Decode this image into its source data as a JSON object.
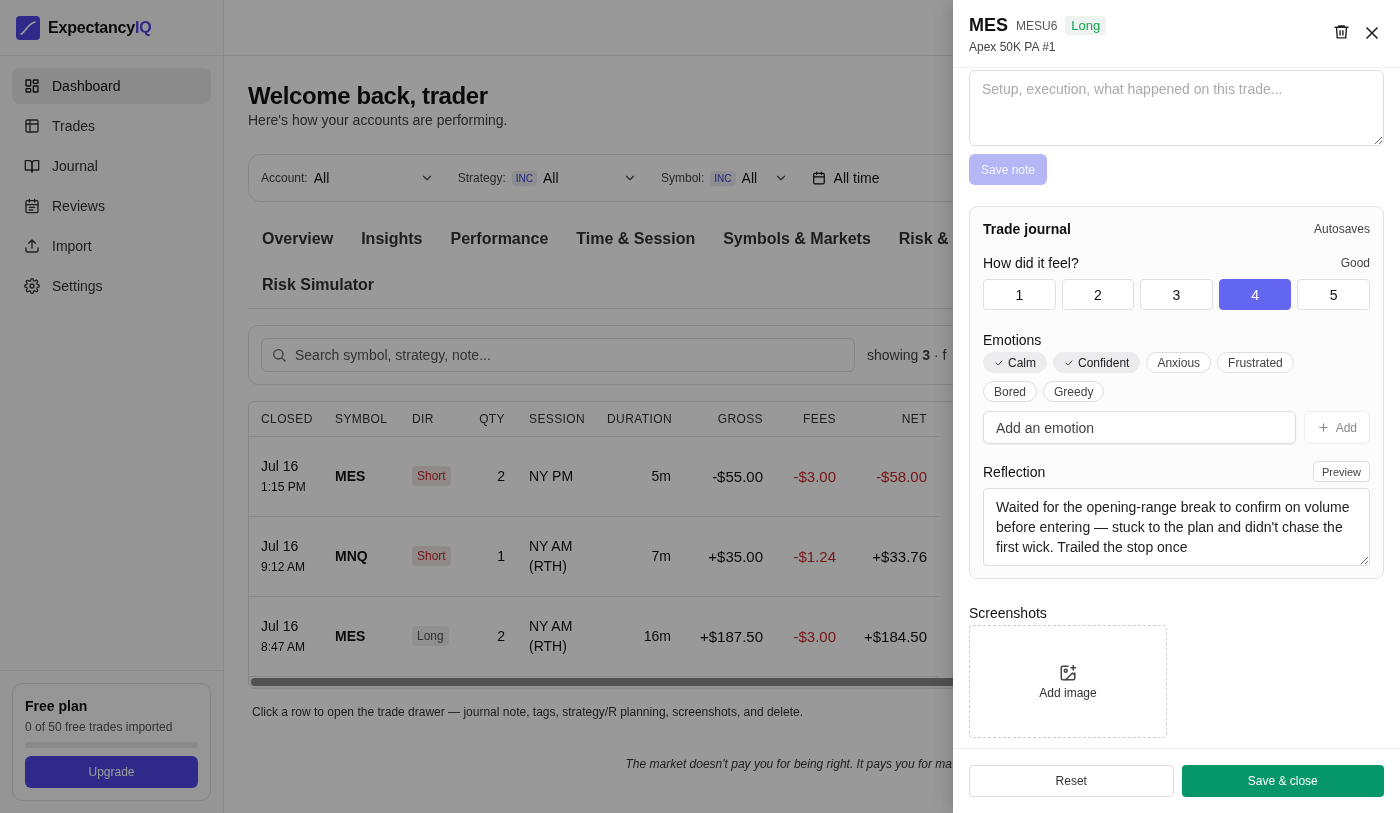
{
  "sidebar": {
    "brand": {
      "name": "Expectancy",
      "accent": "IQ"
    },
    "items": [
      {
        "label": "Dashboard",
        "kind": "dashboard",
        "selected": true
      },
      {
        "label": "Trades",
        "kind": "trades",
        "selected": false
      },
      {
        "label": "Journal",
        "kind": "journal",
        "selected": false
      },
      {
        "label": "Reviews",
        "kind": "reviews",
        "selected": false
      },
      {
        "label": "Import",
        "kind": "import",
        "selected": false
      },
      {
        "label": "Settings",
        "kind": "settings",
        "selected": false
      }
    ],
    "plan": {
      "title": "Free plan",
      "subtitle": "0 of 50 free trades imported",
      "level": 0,
      "button": "Upgrade"
    }
  },
  "main": {
    "title": "Welcome back, trader",
    "subtitle": "Here's how your accounts are performing.",
    "filters": [
      {
        "kind": "select",
        "label": "Account:",
        "value": "All"
      },
      {
        "kind": "select",
        "label": "Strategy:",
        "badge": "INC",
        "value": "All"
      },
      {
        "kind": "select",
        "label": "Symbol:",
        "badge": "INC",
        "value": "All"
      },
      {
        "kind": "date",
        "value": "All time"
      }
    ],
    "tabs": [
      {
        "label": "Overview",
        "selected": false
      },
      {
        "label": "Insights",
        "selected": false
      },
      {
        "label": "Performance",
        "selected": false
      },
      {
        "label": "Time & Session",
        "selected": false
      },
      {
        "label": "Symbols & Markets",
        "selected": false
      },
      {
        "label": "Risk &",
        "selected": false
      },
      {
        "label": "Risk Simulator",
        "selected": false
      }
    ],
    "search": {
      "placeholder": "Search symbol, strategy, note..."
    },
    "showing": "showing **3** · f",
    "table": {
      "columns": [
        "CLOSED",
        "SYMBOL",
        "DIR",
        "QTY",
        "SESSION",
        "DURATION",
        "GROSS",
        "FEES",
        "NET"
      ],
      "rows": [
        {
          "date": "Jul 16",
          "time": "1:15 PM",
          "symbol": "MES",
          "dir": {
            "label": "Short",
            "kind": "short"
          },
          "qty": "2",
          "session": "NY PM",
          "duration": "5m",
          "gross": "-$55.00",
          "fees": {
            "text": "-$3.00",
            "loss": true
          },
          "net": {
            "text": "-$58.00",
            "loss": true
          }
        },
        {
          "date": "Jul 16",
          "time": "9:12 AM",
          "symbol": "MNQ",
          "dir": {
            "label": "Short",
            "kind": "short"
          },
          "qty": "1",
          "session": "NY AM (RTH)",
          "duration": "7m",
          "gross": "+$35.00",
          "fees": {
            "text": "-$1.24",
            "loss": true
          },
          "net": {
            "text": "+$33.76",
            "loss": false
          }
        },
        {
          "date": "Jul 16",
          "time": "8:47 AM",
          "symbol": "MES",
          "dir": {
            "label": "Long",
            "kind": "long"
          },
          "qty": "2",
          "session": "NY AM (RTH)",
          "duration": "16m",
          "gross": "+$187.50",
          "fees": {
            "text": "-$3.00",
            "loss": true
          },
          "net": {
            "text": "+$184.50",
            "loss": false
          }
        }
      ]
    },
    "hint": "Click a row to open the trade drawer — journal note, tags, strategy/R planning, screenshots, and delete.",
    "quote": "The market doesn't pay you for being right. It pays you for ma"
  },
  "drawer": {
    "symbol": "MES",
    "contract": "MESU6",
    "dir": {
      "label": "Long",
      "kind": "long"
    },
    "account": "Apex 50K PA #1",
    "note": {
      "placeholder": "Setup, execution, what happened on this trade...",
      "button": "Save note",
      "disabled": true
    },
    "journal": {
      "title": "Trade journal",
      "status": "Autosaves",
      "question": "How did it feel?",
      "feel": "Good",
      "ratings": [
        {
          "label": "1",
          "selected": false
        },
        {
          "label": "2",
          "selected": false
        },
        {
          "label": "3",
          "selected": false
        },
        {
          "label": "4",
          "selected": true
        },
        {
          "label": "5",
          "selected": false
        }
      ],
      "emotions_label": "Emotions",
      "emotions": [
        {
          "label": "Calm",
          "selected": true
        },
        {
          "label": "Confident",
          "selected": true
        },
        {
          "label": "Anxious",
          "selected": false
        },
        {
          "label": "Frustrated",
          "selected": false
        },
        {
          "label": "Bored",
          "selected": false
        },
        {
          "label": "Greedy",
          "selected": false
        }
      ],
      "emotion_input": {
        "placeholder": "Add an emotion"
      },
      "add_button": {
        "label": "Add",
        "disabled": true
      },
      "reflection_label": "Reflection",
      "preview_button": "Preview",
      "reflection": "Waited for the opening-range break to confirm on volume before entering — stuck to the plan and didn't chase the first wick. Trailed the stop once"
    },
    "screenshots": {
      "label": "Screenshots",
      "add": "Add image"
    },
    "footer": {
      "reset": "Reset",
      "save": "Save & close"
    }
  }
}
